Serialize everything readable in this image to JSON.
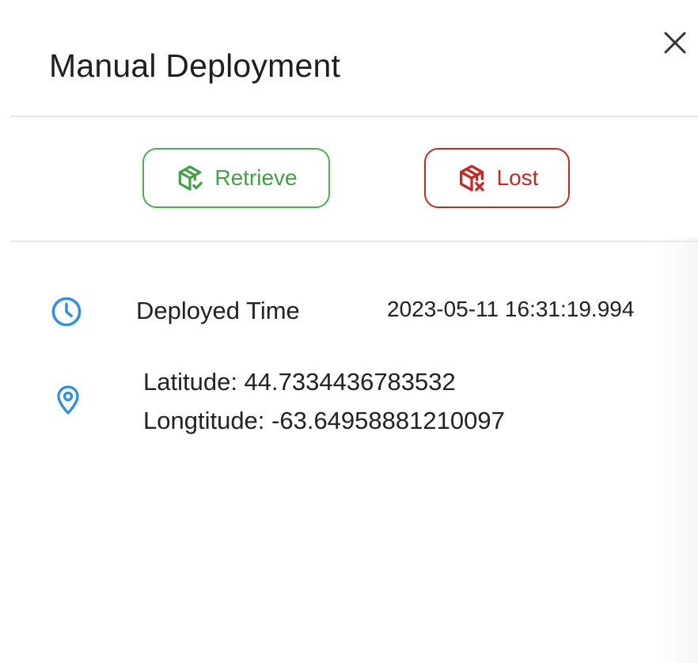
{
  "dialog": {
    "title": "Manual Deployment",
    "close_icon": "close-icon"
  },
  "actions": {
    "retrieve": {
      "label": "Retrieve",
      "icon": "package-check-icon",
      "color": "#43a047"
    },
    "lost": {
      "label": "Lost",
      "icon": "package-x-icon",
      "color": "#c62828"
    }
  },
  "details": {
    "deployed_time": {
      "icon": "clock-icon",
      "label": "Deployed Time",
      "value": "2023-05-11 16:31:19.994"
    },
    "location": {
      "icon": "map-pin-icon",
      "latitude": "Latitude: 44.7334436783532",
      "longitude": "Longtitude: -63.64958881210097"
    },
    "icon_color": "#2f8ee5"
  }
}
